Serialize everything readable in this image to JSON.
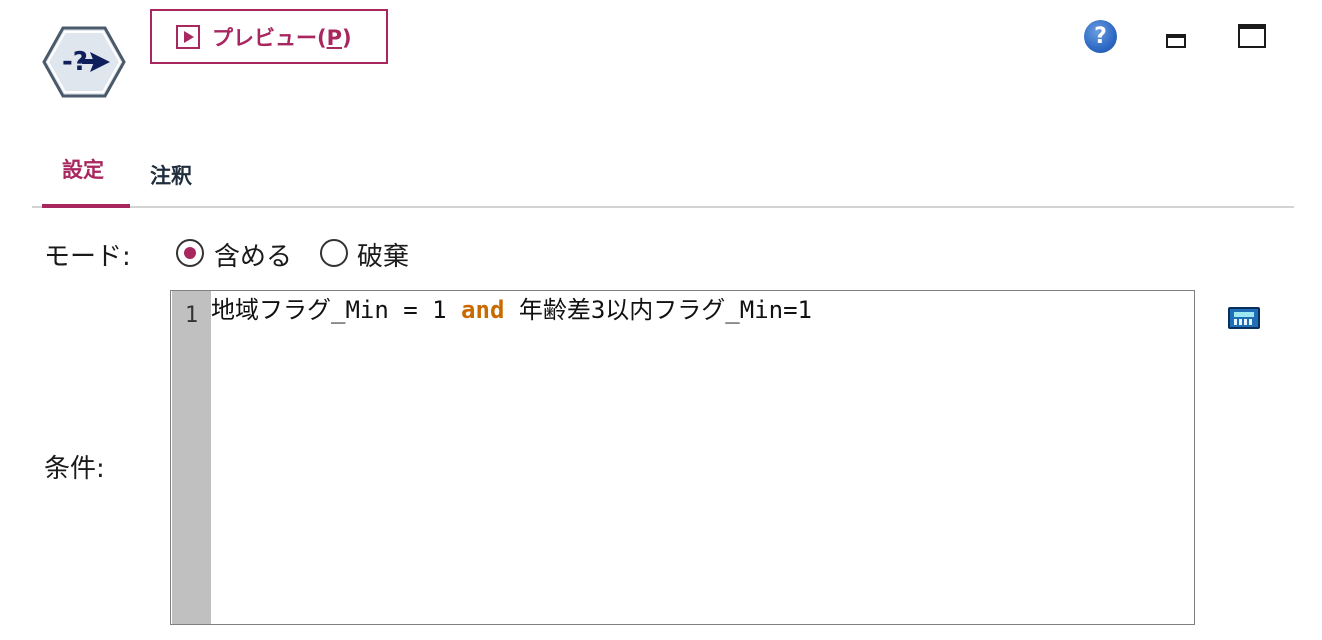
{
  "toolbar": {
    "preview_label": "プレビュー(",
    "preview_key": "P",
    "preview_close": ")",
    "help_glyph": "?"
  },
  "icons": {
    "node": "select-node-icon",
    "help": "help-icon",
    "minimize": "minimize-icon",
    "maximize": "maximize-icon",
    "expression_builder": "expression-builder-icon"
  },
  "tabs": [
    {
      "label": "設定",
      "active": true
    },
    {
      "label": "注釈",
      "active": false
    }
  ],
  "mode": {
    "label": "モード:",
    "options": [
      {
        "label": "含める",
        "selected": true
      },
      {
        "label": "破棄",
        "selected": false
      }
    ]
  },
  "condition": {
    "label": "条件:",
    "line_number": "1",
    "code_before": "地域フラグ_Min = 1 ",
    "code_keyword": "and",
    "code_after": " 年齢差3以内フラグ_Min=1"
  },
  "colors": {
    "accent": "#a8275f",
    "keyword": "#c96a00",
    "gutter": "#c0c0c0"
  }
}
